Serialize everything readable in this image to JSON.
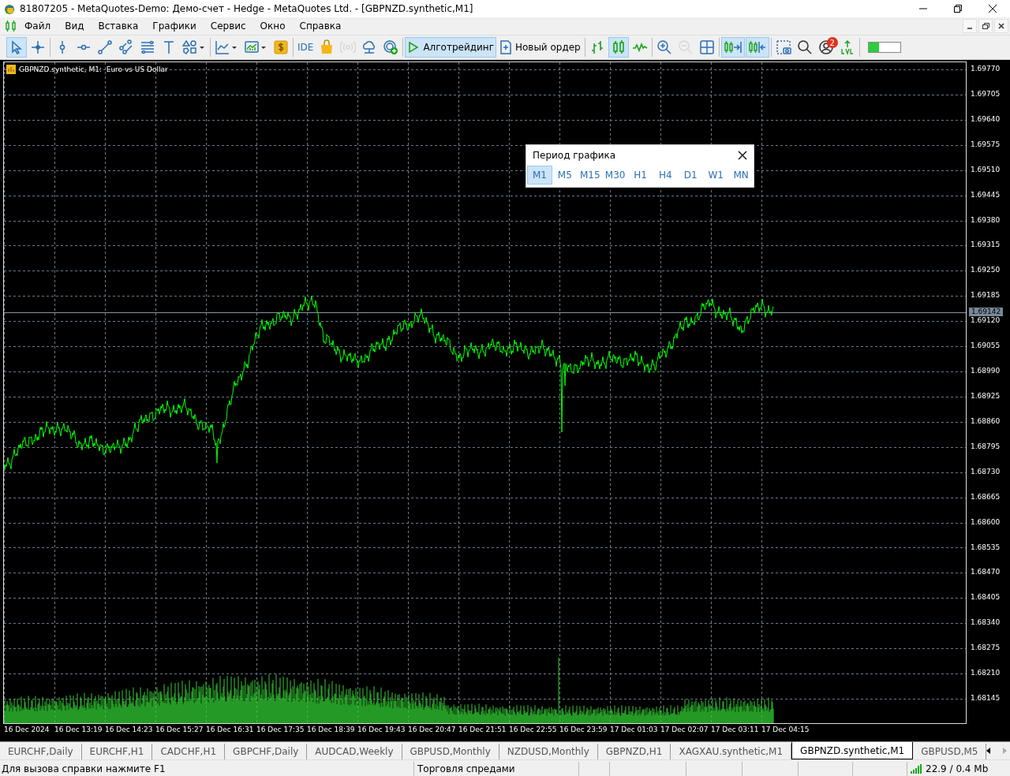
{
  "window": {
    "title": "81807205 - MetaQuotes-Demo: Демо-счет - Hedge - MetaQuotes Ltd. - [GBPNZD.synthetic,M1]"
  },
  "menu": {
    "items": [
      "Файл",
      "Вид",
      "Вставка",
      "Графики",
      "Сервис",
      "Окно",
      "Справка"
    ]
  },
  "toolbar": {
    "groups": [
      [
        {
          "kind": "cursor",
          "selected": true,
          "disabled": false
        },
        {
          "kind": "crosshair",
          "selected": false,
          "disabled": false
        }
      ],
      [
        {
          "kind": "vline",
          "selected": false,
          "disabled": false
        },
        {
          "kind": "hline",
          "selected": false,
          "disabled": false
        },
        {
          "kind": "trendline",
          "selected": false,
          "disabled": false
        },
        {
          "kind": "channel",
          "selected": false,
          "disabled": false
        },
        {
          "kind": "fibo",
          "selected": false,
          "disabled": false
        },
        {
          "kind": "text-tool",
          "selected": false,
          "disabled": false
        },
        {
          "kind": "shapes",
          "selected": false,
          "disabled": false
        }
      ],
      [
        {
          "kind": "indicators",
          "selected": false,
          "disabled": false
        },
        {
          "kind": "template",
          "selected": false,
          "disabled": false
        },
        {
          "kind": "dollar",
          "selected": false,
          "disabled": false
        }
      ],
      [
        {
          "kind": "text",
          "label": "IDE",
          "selected": false,
          "disabled": false
        },
        {
          "kind": "bag",
          "selected": false,
          "disabled": false
        },
        {
          "kind": "signal",
          "selected": false,
          "disabled": true
        },
        {
          "kind": "cloud",
          "selected": false,
          "disabled": false
        },
        {
          "kind": "globe",
          "selected": false,
          "disabled": false
        }
      ],
      [
        {
          "kind": "play",
          "label": "Алготрейдинг",
          "selected": true,
          "disabled": false
        },
        {
          "kind": "order",
          "label": "Новый ордер",
          "selected": false,
          "disabled": false
        }
      ],
      [
        {
          "kind": "bars",
          "selected": false,
          "disabled": false
        },
        {
          "kind": "candles",
          "selected": true,
          "disabled": false
        },
        {
          "kind": "line",
          "selected": false,
          "disabled": false
        }
      ],
      [
        {
          "kind": "zoom-in",
          "selected": false,
          "disabled": false
        },
        {
          "kind": "zoom-out",
          "selected": false,
          "disabled": true
        },
        {
          "kind": "tile",
          "selected": false,
          "disabled": false
        }
      ],
      [
        {
          "kind": "autoscroll",
          "selected": true,
          "disabled": false
        },
        {
          "kind": "shift",
          "selected": true,
          "disabled": false
        }
      ],
      [
        {
          "kind": "screenshot",
          "selected": false,
          "disabled": false
        },
        {
          "kind": "search",
          "selected": false,
          "disabled": false
        },
        {
          "kind": "account",
          "badge": "2",
          "selected": false,
          "disabled": false
        },
        {
          "kind": "lvl",
          "selected": false,
          "disabled": false
        }
      ]
    ],
    "meter": {
      "level": 0.33
    }
  },
  "chart": {
    "symbol_label": "GBPNZD.synthetic, M1:  Euro vs US Dollar",
    "price_labels": [
      "1.69770",
      "1.69705",
      "1.69640",
      "1.69575",
      "1.69510",
      "1.69445",
      "1.69380",
      "1.69315",
      "1.69250",
      "1.69185",
      "1.69120",
      "1.69055",
      "1.68990",
      "1.68925",
      "1.68860",
      "1.68795",
      "1.68730",
      "1.68665",
      "1.68600",
      "1.68535",
      "1.68470",
      "1.68405",
      "1.68340",
      "1.68275",
      "1.68210",
      "1.68145"
    ],
    "current_price": "1.69142",
    "time_labels": [
      "16 Dec 2024",
      "16 Dec 13:19",
      "16 Dec 14:23",
      "16 Dec 15:27",
      "16 Dec 16:31",
      "16 Dec 17:35",
      "16 Dec 18:39",
      "16 Dec 19:43",
      "16 Dec 20:47",
      "16 Dec 21:51",
      "16 Dec 22:55",
      "16 Dec 23:59",
      "17 Dec 01:03",
      "17 Dec 02:07",
      "17 Dec 03:11",
      "17 Dec 04:15"
    ]
  },
  "period_dialog": {
    "title": "Период графика",
    "periods": [
      {
        "label": "M1",
        "selected": true
      },
      {
        "label": "M5",
        "selected": false
      },
      {
        "label": "M15",
        "selected": false
      },
      {
        "label": "M30",
        "selected": false
      },
      {
        "label": "H1",
        "selected": false
      },
      {
        "label": "H4",
        "selected": false
      },
      {
        "label": "D1",
        "selected": false
      },
      {
        "label": "W1",
        "selected": false
      },
      {
        "label": "MN",
        "selected": false
      }
    ]
  },
  "tabs": [
    {
      "label": "EURCHF,Daily",
      "selected": false
    },
    {
      "label": "EURCHF,H1",
      "selected": false
    },
    {
      "label": "CADCHF,H1",
      "selected": false
    },
    {
      "label": "GBPCHF,Daily",
      "selected": false
    },
    {
      "label": "AUDCAD,Weekly",
      "selected": false
    },
    {
      "label": "GBPUSD,Monthly",
      "selected": false
    },
    {
      "label": "NZDUSD,Monthly",
      "selected": false
    },
    {
      "label": "GBPNZD,H1",
      "selected": false
    },
    {
      "label": "XAGXAU.synthetic,M1",
      "selected": false
    },
    {
      "label": "GBPNZD.synthetic,M1",
      "selected": true
    },
    {
      "label": "GBPUSD,M5",
      "selected": false
    }
  ],
  "status_bar": {
    "help": "Для вызова справки нажмите F1",
    "mode": "Торговля спредами",
    "traffic": "22.9 / 0.4 Mb"
  }
}
